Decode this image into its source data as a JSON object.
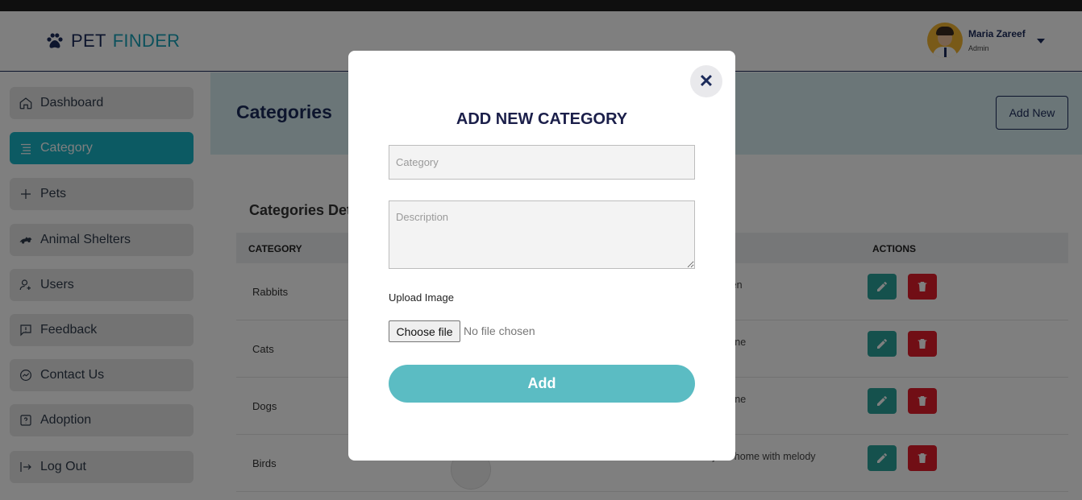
{
  "app": {
    "logo_word1": "PET",
    "logo_word2": "FINDER",
    "user_name": "Maria Zareef",
    "user_role": "Admin"
  },
  "sidebar": {
    "items": [
      {
        "label": "Dashboard",
        "icon": "home-icon",
        "active": false
      },
      {
        "label": "Category",
        "icon": "list-icon",
        "active": true
      },
      {
        "label": "Pets",
        "icon": "plus-icon",
        "active": false
      },
      {
        "label": "Animal Shelters",
        "icon": "shelter-icon",
        "active": false
      },
      {
        "label": "Users",
        "icon": "user-add-icon",
        "active": false
      },
      {
        "label": "Feedback",
        "icon": "feedback-icon",
        "active": false
      },
      {
        "label": "Contact Us",
        "icon": "chat-icon",
        "active": false
      },
      {
        "label": "Adoption",
        "icon": "help-box-icon",
        "active": false
      },
      {
        "label": "Log Out",
        "icon": "logout-icon",
        "active": false
      }
    ]
  },
  "main": {
    "title": "Categories",
    "add_new_label": "Add New",
    "card_title": "Categories Det",
    "columns": {
      "category": "CATEGORY",
      "actions": "ACTIONS"
    },
    "rows": [
      {
        "name": "Rabbits",
        "desc": "ts that will brighten"
      },
      {
        "name": "Cats",
        "desc": "d affectionate feline"
      },
      {
        "name": "Dogs",
        "desc": "d affectionate feline"
      },
      {
        "name": "Birds",
        "desc": "ions that fill your home with melody"
      }
    ]
  },
  "modal": {
    "close_glyph": "✕",
    "title": "ADD NEW CATEGORY",
    "category_placeholder": "Category",
    "description_placeholder": "Description",
    "upload_label": "Upload Image",
    "choose_file_label": "Choose file",
    "no_file_text": "No file chosen",
    "submit_label": "Add"
  },
  "colors": {
    "brand_navy": "#1b2a5a",
    "brand_teal": "#19a3b8",
    "active_nav": "#19b4c6",
    "add_button": "#5bbcc3",
    "edit_button": "#2aa39a",
    "delete_button": "#e31d2a"
  }
}
